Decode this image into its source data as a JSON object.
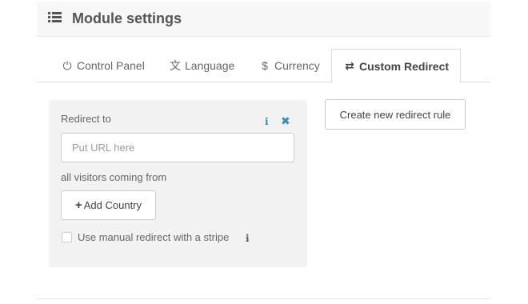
{
  "header": {
    "title": "Module settings",
    "icon": "list-icon"
  },
  "tabs": [
    {
      "label": "Control Panel",
      "icon": "power-icon",
      "glyph": "⏻"
    },
    {
      "label": "Language",
      "icon": "language-icon",
      "glyph": "文"
    },
    {
      "label": "Currency",
      "icon": "dollar-icon",
      "glyph": "$"
    },
    {
      "label": "Custom Redirect",
      "icon": "exchange-icon",
      "glyph": "⇄",
      "active": true
    }
  ],
  "rule_panel": {
    "redirect_label": "Redirect to",
    "url_placeholder": "Put URL here",
    "url_value": "",
    "visitors_label": "all visitors coming from",
    "add_country_label": "Add Country",
    "manual_label": "Use manual redirect with a stripe",
    "manual_checked": false,
    "info_glyph": "i",
    "close_glyph": "✖"
  },
  "create_rule_label": "Create new redirect rule",
  "colors": {
    "accent": "#2f8fc4",
    "panel_bg": "#f2f2f2",
    "header_bg": "#f7f7f7"
  }
}
